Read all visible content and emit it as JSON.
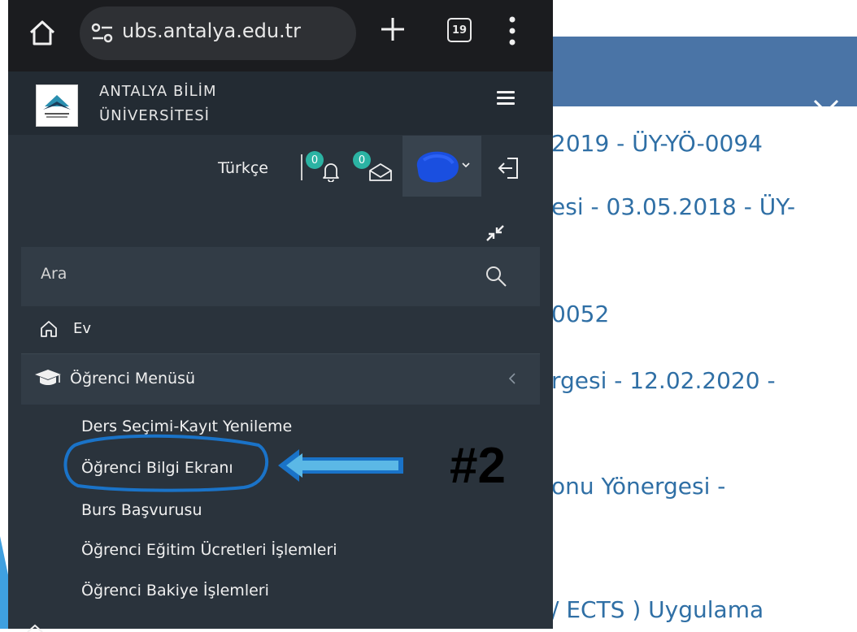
{
  "browser": {
    "url": "ubs.antalya.edu.tr",
    "tab_count": "19"
  },
  "app": {
    "brand_line1": "ANTALYA BİLİM",
    "brand_line2": "ÜNİVERSİTESİ",
    "language": "Türkçe",
    "notifications_count": "0",
    "messages_count": "0",
    "search_placeholder": "Ara",
    "menu": {
      "home_label": "Ev",
      "student_menu_label": "Öğrenci Menüsü",
      "sub_items": [
        "Ders Seçimi-Kayıt Yenileme",
        "Öğrenci Bilgi Ekranı",
        "Burs Başvurusu",
        "Öğrenci Eğitim Ücretleri İşlemleri",
        "Öğrenci Bakiye İşlemleri"
      ]
    }
  },
  "background_page": {
    "lines": [
      "2019 - ÜY-YÖ-0094",
      "esi - 03.05.2018 - ÜY-",
      "0052",
      "rgesi - 12.02.2020 -",
      "onu Yönergesi -",
      "/ ECTS ) Uygulama"
    ]
  },
  "annotation": {
    "label": "#2",
    "accent_color": "#1a73c8",
    "arrow_color": "#5bb8e6"
  }
}
